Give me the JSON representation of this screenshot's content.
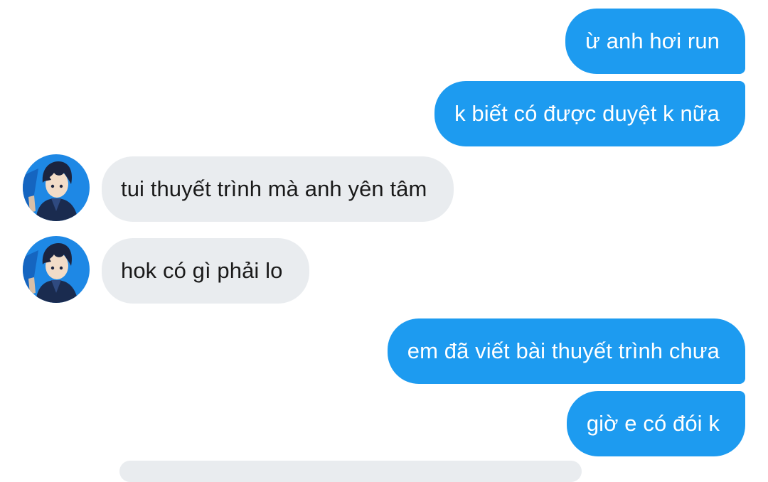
{
  "messages": [
    {
      "side": "outgoing",
      "text": "ừ anh hơi run"
    },
    {
      "side": "outgoing",
      "text": "k biết có được duyệt k nữa"
    },
    {
      "side": "incoming",
      "text": "tui thuyết trình mà anh yên tâm"
    },
    {
      "side": "incoming",
      "text": "hok có gì phải lo"
    },
    {
      "side": "outgoing",
      "text": "em đã viết bài thuyết trình chưa"
    },
    {
      "side": "outgoing",
      "text": "giờ e có đói k"
    }
  ],
  "colors": {
    "outgoing_bubble": "#1d9bf0",
    "incoming_bubble": "#e9ecef",
    "outgoing_text": "#ffffff",
    "incoming_text": "#1a1a1a",
    "avatar_background": "#1e88e5"
  }
}
